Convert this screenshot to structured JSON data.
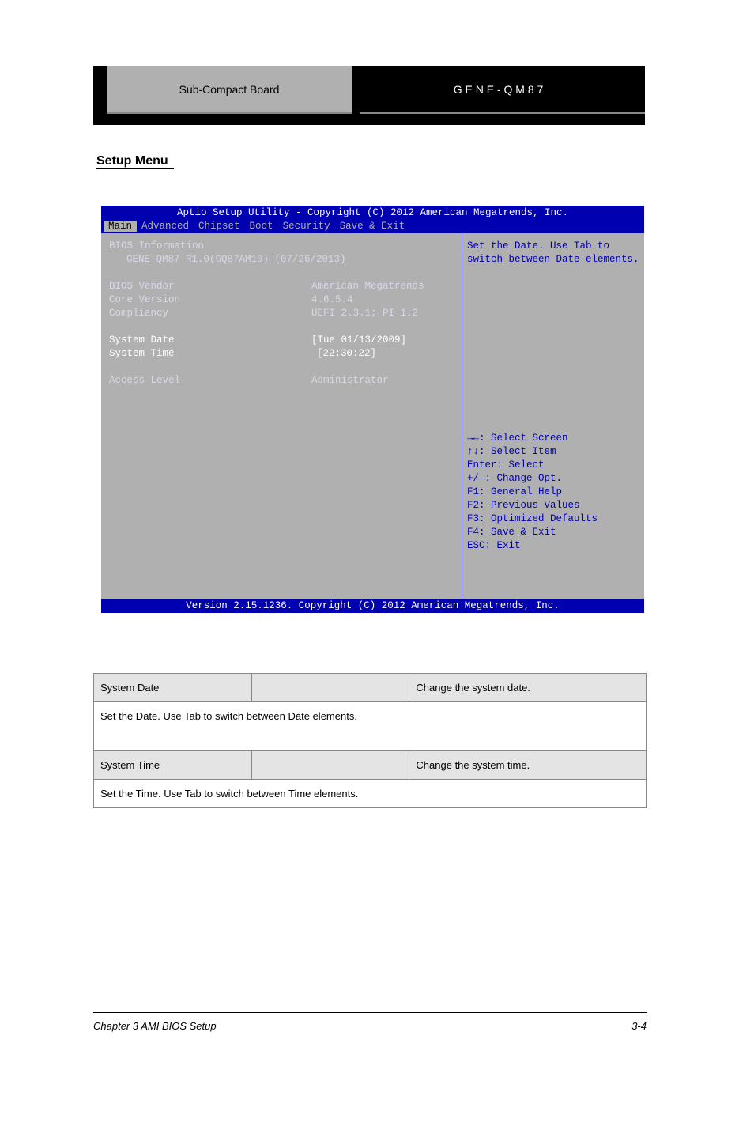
{
  "header": {
    "left_label": "Sub-Compact Board",
    "right_label": "G E N E - Q M 8 7"
  },
  "section": {
    "heading": "Setup Menu"
  },
  "bios": {
    "title": "Aptio Setup Utility - Copyright (C) 2012 American Megatrends, Inc.",
    "tabs": [
      "Main",
      "Advanced",
      "Chipset",
      "Boot",
      "Security",
      "Save & Exit"
    ],
    "active_tab": "Main",
    "info_header": "BIOS Information",
    "info_sub": "GENE-QM87 R1.0(GQ87AM10) (07/26/2013)",
    "rows": [
      {
        "label": "BIOS Vendor",
        "value": "American Megatrends",
        "selected": false
      },
      {
        "label": "Core Version",
        "value": "4.6.5.4",
        "selected": false
      },
      {
        "label": "Compliancy",
        "value": "UEFI 2.3.1; PI 1.2",
        "selected": false
      }
    ],
    "date_row": {
      "label": "System Date",
      "value": "[Tue 01/13/2009]",
      "selected": true
    },
    "time_row": {
      "label": "System Time",
      "value": "[22:30:22]",
      "selected": false
    },
    "access_row": {
      "label": "Access Level",
      "value": "Administrator",
      "selected": false
    },
    "help_text_1": "Set the Date. Use Tab to",
    "help_text_2": "switch between Date elements.",
    "keys": [
      "→←: Select Screen",
      "↑↓: Select Item",
      "Enter: Select",
      "+/-: Change Opt.",
      "F1: General Help",
      "F2: Previous Values",
      "F3: Optimized Defaults",
      "F4: Save & Exit",
      "ESC: Exit"
    ],
    "footer": "Version 2.15.1236. Copyright (C) 2012 American Megatrends, Inc."
  },
  "table": {
    "header_row_1": [
      "System Date",
      "",
      "Change the system date."
    ],
    "full_row_1": "Set the Date. Use Tab to switch between Date elements.",
    "header_row_2": [
      "System Time",
      "",
      "Change the system time."
    ],
    "full_row_2": "Set the Time. Use Tab to switch between Time elements."
  },
  "footer": {
    "chapter": "Chapter 3 AMI BIOS Setup",
    "page": "3-4"
  }
}
